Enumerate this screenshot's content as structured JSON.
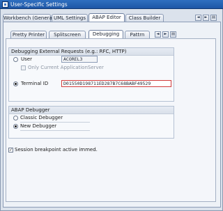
{
  "window": {
    "title": "User-Specific Settings"
  },
  "outer_tabs": [
    "Workbench (General)",
    "UML Settings",
    "ABAP Editor",
    "Class Builder"
  ],
  "outer_active": "ABAP Editor",
  "nav": {
    "left": "◄",
    "right": "►",
    "menu": "▤"
  },
  "inner_tabs": [
    "Pretty Printer",
    "Splitscreen",
    "Debugging",
    "Pattrn"
  ],
  "inner_active": "Debugging",
  "external_requests": {
    "title": "Debugging External Requests (e.g.: RFC, HTTP)",
    "user_label": "User",
    "user_value": "ACOREL3",
    "only_current_label": "Only Current ApplicationServer",
    "terminal_label": "Terminal ID",
    "terminal_value": "D01550D198711ED287B7C68BABF49529",
    "selected": "terminal"
  },
  "abap_debugger": {
    "title": "ABAP Debugger",
    "classic_label": "Classic Debugger",
    "new_label": "New Debugger",
    "selected": "new"
  },
  "session_breakpoint": {
    "label": "Session breakpoint active immed.",
    "checked": true,
    "mark": "✓"
  }
}
